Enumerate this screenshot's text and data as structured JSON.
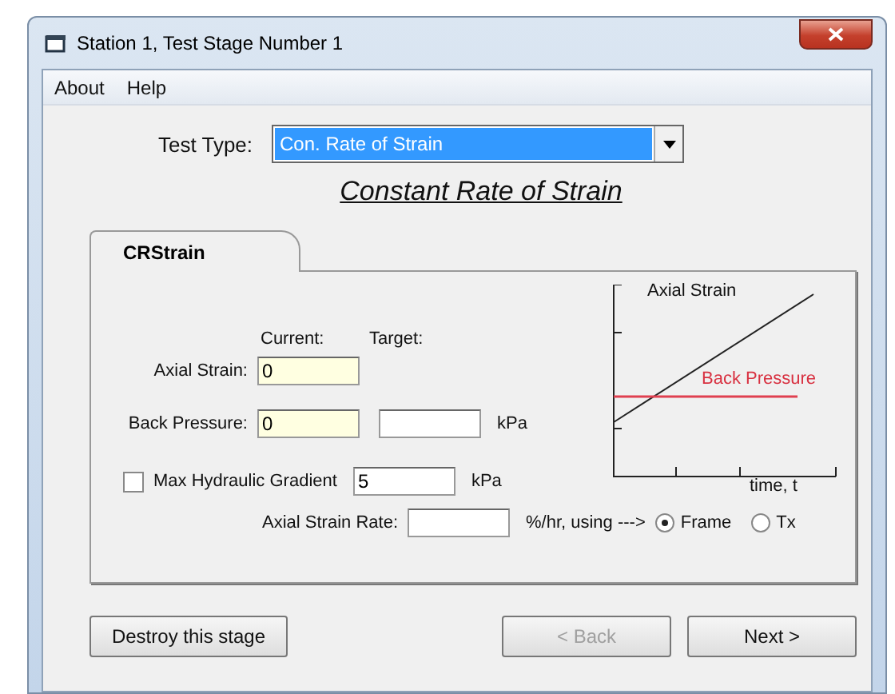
{
  "window": {
    "title": "Station 1, Test Stage Number 1"
  },
  "menu": [
    "About",
    "Help"
  ],
  "test_type": {
    "label": "Test Type:",
    "value": "Con. Rate of Strain"
  },
  "heading": "Constant Rate of Strain",
  "tabs": [
    {
      "label": "CRStrain",
      "selected": true
    }
  ],
  "columns": [
    "Current:",
    "Target:"
  ],
  "axial_strain": {
    "label": "Axial Strain:",
    "current": "0"
  },
  "back_pressure": {
    "label": "Back Pressure:",
    "current": "0",
    "unit": "kPa"
  },
  "max_gradient": {
    "label": "Max Hydraulic Gradient",
    "checked": false,
    "value": "5",
    "unit": "kPa"
  },
  "strain_rate": {
    "label": "Axial Strain Rate:",
    "unit": "%/hr, using --->",
    "options": [
      {
        "label": "Frame",
        "selected": true
      },
      {
        "label": "Tx",
        "selected": false
      }
    ]
  },
  "chart": {
    "labels": [
      "Axial Strain",
      "Back Pressure",
      "time, t"
    ]
  },
  "buttons": [
    {
      "label": "Destroy this stage",
      "disabled": false
    },
    {
      "label": "< Back",
      "disabled": true
    },
    {
      "label": "Next >",
      "disabled": false
    }
  ]
}
